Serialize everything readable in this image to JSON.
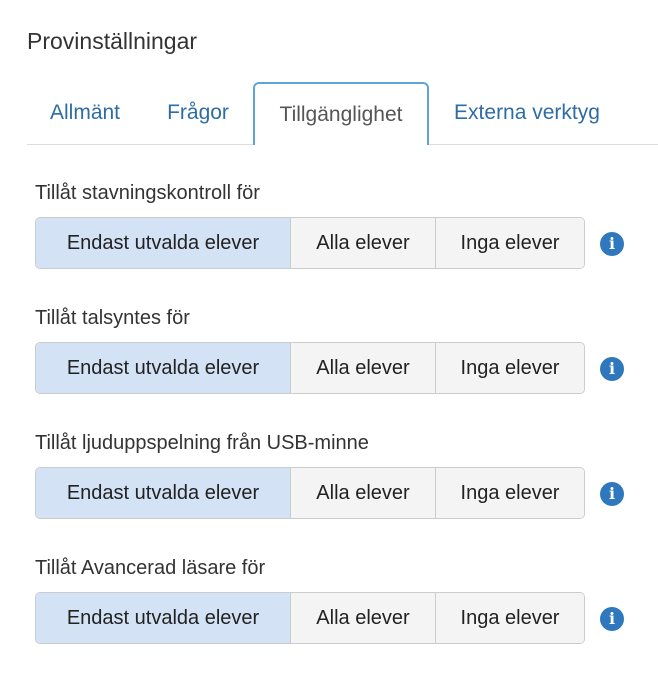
{
  "page": {
    "title": "Provinställningar"
  },
  "tabs": [
    {
      "label": "Allmänt",
      "active": false
    },
    {
      "label": "Frågor",
      "active": false
    },
    {
      "label": "Tillgänglighet",
      "active": true
    },
    {
      "label": "Externa verktyg",
      "active": false
    }
  ],
  "settings": [
    {
      "label": "Tillåt stavningskontroll för",
      "options": [
        "Endast utvalda elever",
        "Alla elever",
        "Inga elever"
      ],
      "selected": "Endast utvalda elever",
      "info_icon": "info-icon"
    },
    {
      "label": "Tillåt talsyntes för",
      "options": [
        "Endast utvalda elever",
        "Alla elever",
        "Inga elever"
      ],
      "selected": "Endast utvalda elever",
      "info_icon": "info-icon"
    },
    {
      "label": "Tillåt ljuduppspelning från USB-minne",
      "options": [
        "Endast utvalda elever",
        "Alla elever",
        "Inga elever"
      ],
      "selected": "Endast utvalda elever",
      "info_icon": "info-icon"
    },
    {
      "label": "Tillåt Avancerad läsare för",
      "options": [
        "Endast utvalda elever",
        "Alla elever",
        "Inga elever"
      ],
      "selected": "Endast utvalda elever",
      "info_icon": "info-icon"
    }
  ],
  "colors": {
    "link": "#2e6da4",
    "active_tab_border": "#5ea3d9",
    "selected_option_bg": "#d3e2f5",
    "option_bg": "#f4f4f4",
    "info_icon_bg": "#2f78be"
  }
}
